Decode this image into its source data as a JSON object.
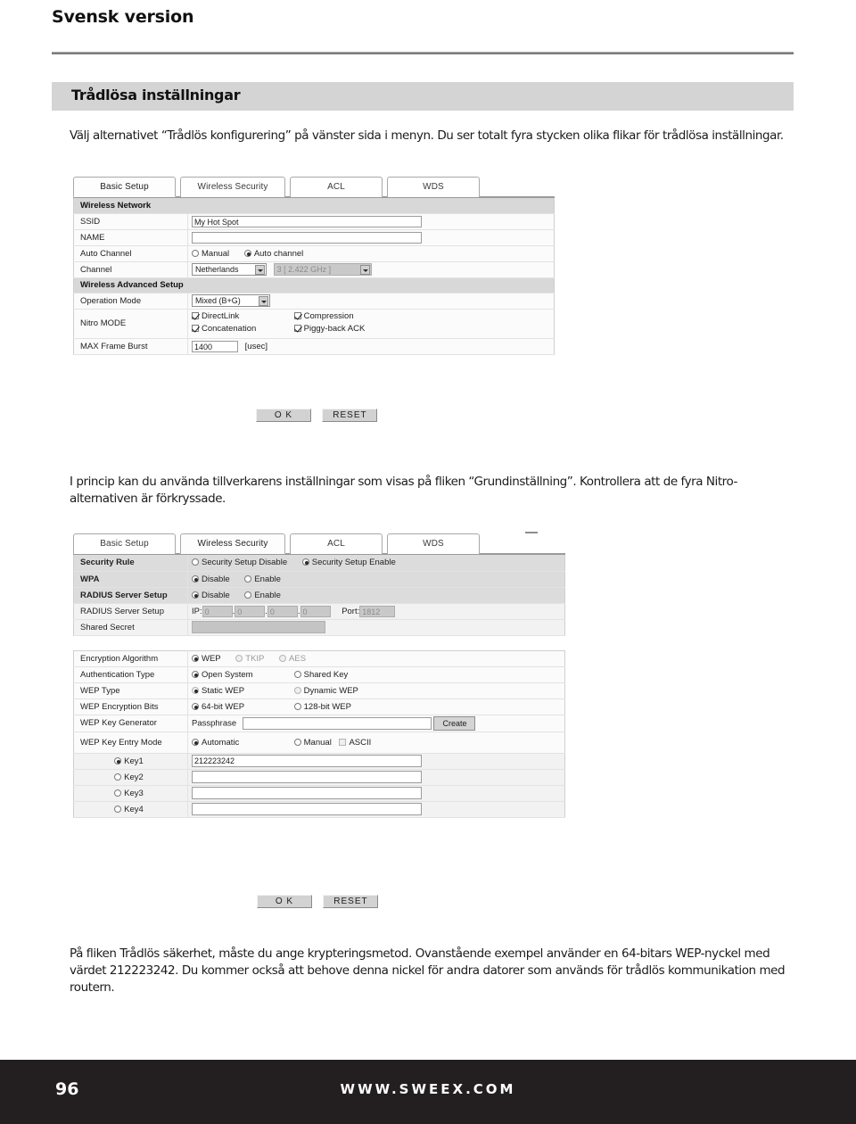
{
  "page": {
    "title": "Svensk version",
    "section_heading": "Trådlösa inställningar",
    "intro_text": "Välj alternativet “Trådlös konfigurering” på vänster sida i menyn. Du ser totalt fyra stycken olika flikar för trådlösa inställningar.",
    "mid_text": "I princip kan du använda tillverkarens inställningar som visas på fliken “Grundinställning”. Kontrollera att de fyra Nitro-alternativen är förkryssade.",
    "outro_text": "På fliken Trådlös säkerhet, måste du ange krypteringsmetod. Ovanstående exempel använder en 64-bitars WEP-nyckel med värdet 212223242. Du kommer också att behove denna nickel för andra datorer som används för trådlös kommunikation med routern."
  },
  "footer": {
    "page_number": "96",
    "url": "WWW.SWEEX.COM"
  },
  "buttons": {
    "ok": "O K",
    "reset": "RESET",
    "create": "Create"
  },
  "screenshot_basic": {
    "tabs": [
      {
        "label": "Basic Setup",
        "active": true
      },
      {
        "label": "Wireless Security",
        "active": false
      },
      {
        "label": "ACL",
        "active": false
      },
      {
        "label": "WDS",
        "active": false
      }
    ],
    "group_wireless_network": "Wireless Network",
    "group_advanced": "Wireless Advanced Setup",
    "rows": {
      "ssid_label": "SSID",
      "ssid_value": "My Hot Spot",
      "name_label": "NAME",
      "name_value": "",
      "auto_channel_label": "Auto Channel",
      "auto_channel_opt_manual": "Manual",
      "auto_channel_opt_auto": "Auto channel",
      "channel_label": "Channel",
      "channel_country": "Netherlands",
      "channel_value": "3 [ 2.422 GHz ]",
      "operation_mode_label": "Operation Mode",
      "operation_mode_value": "Mixed (B+G)",
      "nitro_label": "Nitro MODE",
      "nitro_directlink": "DirectLink",
      "nitro_compression": "Compression",
      "nitro_concatenation": "Concatenation",
      "nitro_piggyback": "Piggy-back ACK",
      "max_frame_label": "MAX Frame Burst",
      "max_frame_value": "1400",
      "max_frame_unit": "[usec]"
    }
  },
  "screenshot_security": {
    "tabs": [
      {
        "label": "Basic Setup",
        "active": false
      },
      {
        "label": "Wireless Security",
        "active": true
      },
      {
        "label": "ACL",
        "active": false
      },
      {
        "label": "WDS",
        "active": false
      }
    ],
    "rows": {
      "security_rule_label": "Security Rule",
      "security_rule_opt_disable": "Security Setup Disable",
      "security_rule_opt_enable": "Security Setup Enable",
      "wpa_label": "WPA",
      "wpa_opt_disable": "Disable",
      "wpa_opt_enable": "Enable",
      "radius_label": "RADIUS Server Setup",
      "radius_opt_disable": "Disable",
      "radius_opt_enable": "Enable",
      "radius_setup_label": "RADIUS Server Setup",
      "ip_prefix": "IP:",
      "ip_octet1": "0",
      "ip_octet2": "0",
      "ip_octet3": "0",
      "ip_octet4": "0",
      "port_prefix": "Port:",
      "port_value": "1812",
      "shared_secret_label": "Shared Secret",
      "shared_secret_value": "",
      "encryption_label": "Encryption Algorithm",
      "encryption_wep": "WEP",
      "encryption_tkip": "TKIP",
      "encryption_aes": "AES",
      "auth_label": "Authentication Type",
      "auth_open": "Open System",
      "auth_shared": "Shared Key",
      "wep_type_label": "WEP Type",
      "wep_type_static": "Static WEP",
      "wep_type_dynamic": "Dynamic WEP",
      "wep_bits_label": "WEP Encryption Bits",
      "wep_bits_64": "64-bit WEP",
      "wep_bits_128": "128-bit WEP",
      "wep_keygen_label": "WEP Key Generator",
      "wep_keygen_passphrase_label": "Passphrase",
      "wep_keygen_passphrase_value": "",
      "wep_entry_label": "WEP Key Entry Mode",
      "wep_entry_automatic": "Automatic",
      "wep_entry_manual": "Manual",
      "wep_entry_ascii": "ASCII",
      "key1_label": "Key1",
      "key1_value": "212223242",
      "key2_label": "Key2",
      "key2_value": "",
      "key3_label": "Key3",
      "key3_value": "",
      "key4_label": "Key4",
      "key4_value": ""
    }
  }
}
